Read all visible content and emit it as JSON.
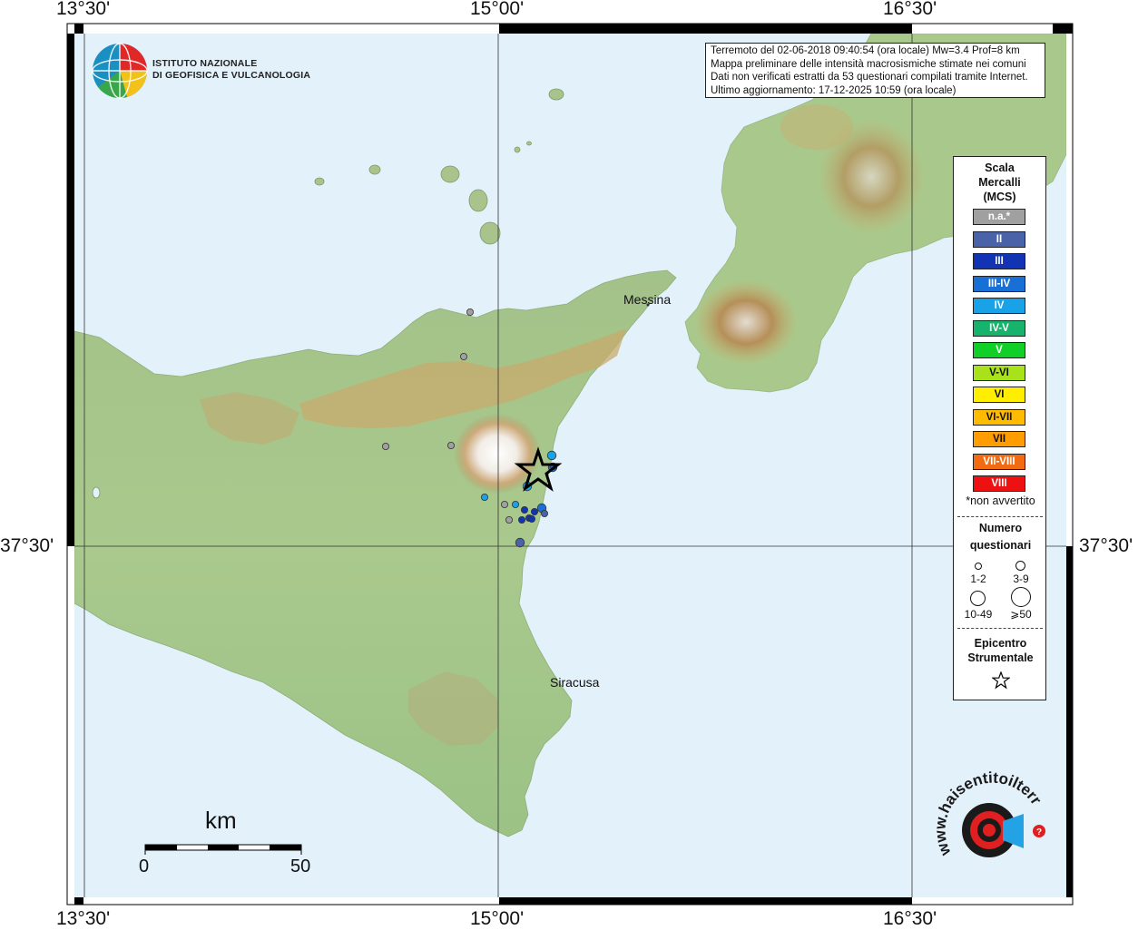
{
  "grid_labels": {
    "lon_left": "13°30'",
    "lon_center": "15°00'",
    "lon_right": "16°30'",
    "lat": "37°30'"
  },
  "institute": {
    "line1": "ISTITUTO NAZIONALE",
    "line2": "DI GEOFISICA E VULCANOLOGIA"
  },
  "info": {
    "line1": "Terremoto del 02-06-2018 09:40:54 (ora locale) Mw=3.4 Prof=8 km",
    "line2": "Mappa preliminare delle intensità macrosismiche stimate nei comuni",
    "line3": "Dati non verificati estratti da 53 questionari compilati tramite Internet.",
    "line4": "Ultimo aggiornamento: 17-12-2025 10:59 (ora locale)"
  },
  "cities": {
    "messina": "Messina",
    "siracusa": "Siracusa"
  },
  "legend": {
    "title1": "Scala",
    "title2": "Mercalli",
    "title3": "(MCS)",
    "classes": [
      {
        "label": "n.a.*",
        "color": "#a0a0a0"
      },
      {
        "label": "II",
        "color": "#4a62a8"
      },
      {
        "label": "III",
        "color": "#1233b4"
      },
      {
        "label": "III-IV",
        "color": "#1870d6"
      },
      {
        "label": "IV",
        "color": "#1aa2e8"
      },
      {
        "label": "IV-V",
        "color": "#17b36c"
      },
      {
        "label": "V",
        "color": "#10d028"
      },
      {
        "label": "V-VI",
        "color": "#a8e21a"
      },
      {
        "label": "VI",
        "color": "#ffee00"
      },
      {
        "label": "VI-VII",
        "color": "#ffbb00"
      },
      {
        "label": "VII",
        "color": "#ff9c00"
      },
      {
        "label": "VII-VIII",
        "color": "#f26b10"
      },
      {
        "label": "VIII",
        "color": "#ee1111"
      }
    ],
    "note": "*non avvertito",
    "count_title1": "Numero",
    "count_title2": "questionari",
    "count_labels": [
      "1-2",
      "3-9",
      "10-49",
      "⩾50"
    ],
    "epicenter_title1": "Epicentro",
    "epicenter_title2": "Strumentale"
  },
  "scalebar": {
    "title": "km",
    "min": "0",
    "max": "50"
  },
  "watermark": {
    "text": "www.haisentitoilterremoto.it"
  },
  "observations": [
    {
      "intensity": "n.a.*",
      "count": "1-2"
    },
    {
      "intensity": "n.a.*",
      "count": "1-2"
    },
    {
      "intensity": "n.a.*",
      "count": "1-2"
    },
    {
      "intensity": "n.a.*",
      "count": "1-2"
    },
    {
      "intensity": "n.a.*",
      "count": "1-2"
    },
    {
      "intensity": "n.a.*",
      "count": "1-2"
    },
    {
      "intensity": "IV",
      "count": "1-2"
    },
    {
      "intensity": "IV",
      "count": "3-9"
    },
    {
      "intensity": "IV",
      "count": "1-2"
    },
    {
      "intensity": "IV",
      "count": "3-9"
    },
    {
      "intensity": "III",
      "count": "1-2"
    },
    {
      "intensity": "III",
      "count": "1-2"
    },
    {
      "intensity": "III",
      "count": "1-2"
    },
    {
      "intensity": "III",
      "count": "1-2"
    },
    {
      "intensity": "III",
      "count": "1-2"
    },
    {
      "intensity": "III-IV",
      "count": "3-9"
    },
    {
      "intensity": "III-IV",
      "count": "3-9"
    },
    {
      "intensity": "III-IV",
      "count": "1-2"
    },
    {
      "intensity": "II",
      "count": "3-9"
    },
    {
      "intensity": "II",
      "count": "1-2"
    }
  ]
}
